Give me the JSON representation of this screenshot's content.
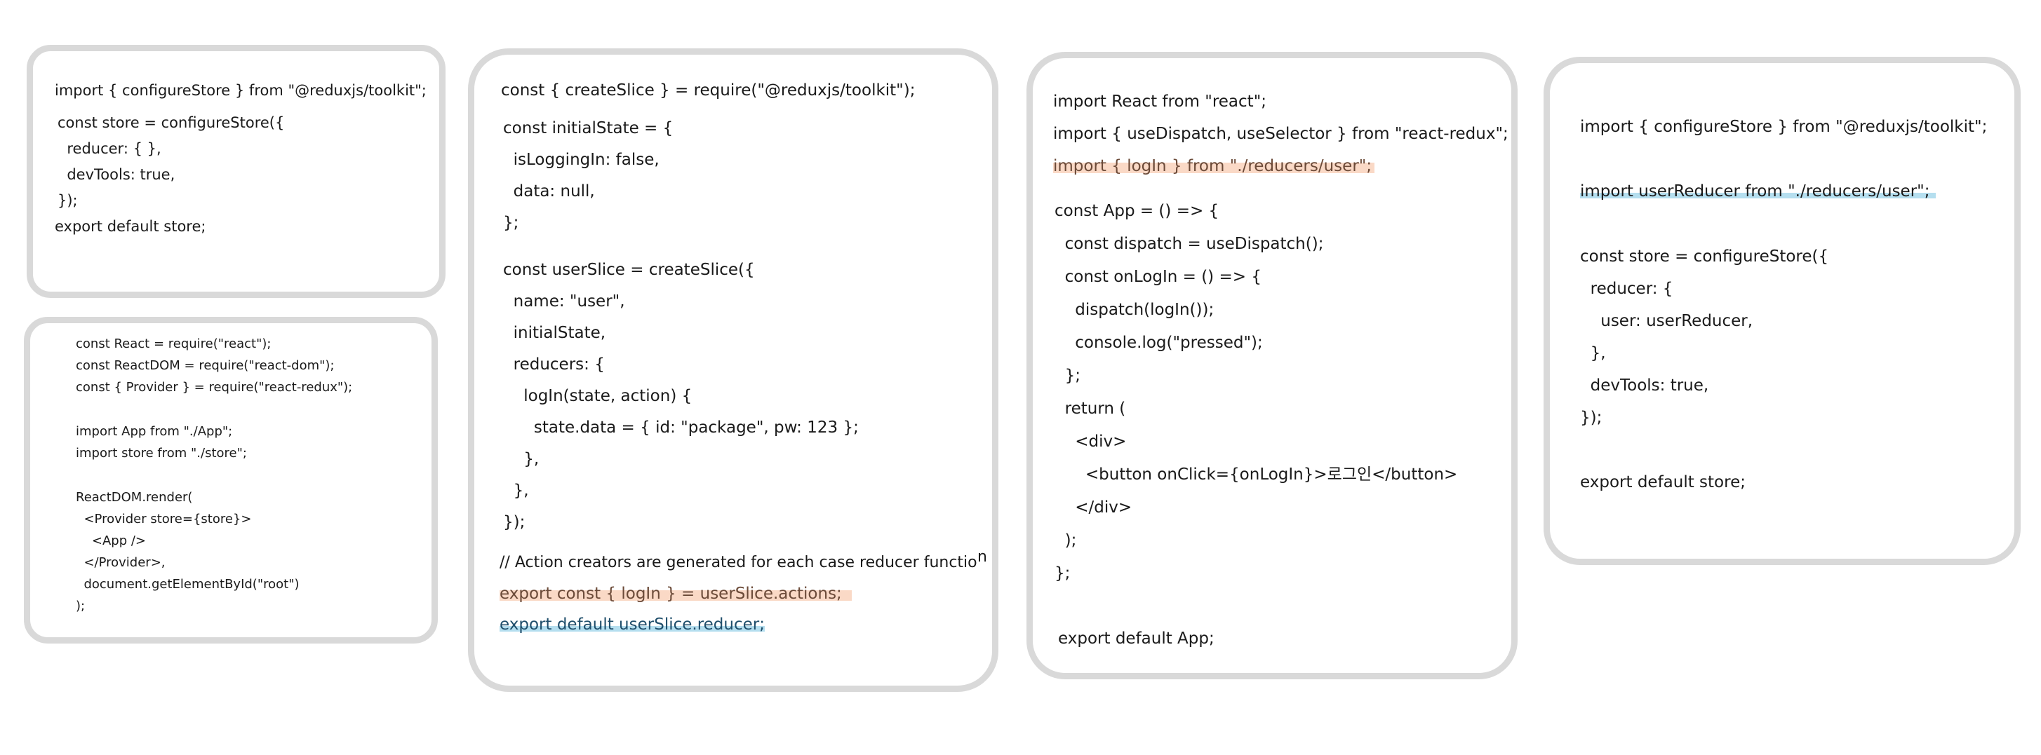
{
  "panels": {
    "store_basic": {
      "lines": [
        "import { configureStore } from \"@reduxjs/toolkit\";",
        "const store = configureStore({",
        "  reducer: { },",
        "  devTools: true,",
        "});",
        "export default store;"
      ]
    },
    "index": {
      "lines": [
        "const React = require(\"react\");",
        "const ReactDOM = require(\"react-dom\");",
        "const { Provider } = require(\"react-redux\");",
        "import App from \"./App\";",
        "import store from \"./store\";",
        "ReactDOM.render(",
        "  <Provider store={store}>",
        "    <App />",
        "  </Provider>,",
        "  document.getElementById(\"root\")",
        ");"
      ]
    },
    "user_slice": {
      "lines": [
        "const { createSlice } = require(\"@reduxjs/toolkit\");",
        "const initialState = {",
        "  isLoggingIn: false,",
        "  data: null,",
        "};",
        "const userSlice = createSlice({",
        "  name: \"user\",",
        "  initialState,",
        "  reducers: {",
        "    logIn(state, action) {",
        "      state.data = { id: \"package\", pw: 123 };",
        "    },",
        "  },",
        "});",
        "// Action creators are generated for each case reducer functio",
        "n",
        "export const { logIn } = userSlice.actions;",
        "export default userSlice.reducer;"
      ]
    },
    "app": {
      "lines": [
        "import React from \"react\";",
        "import { useDispatch, useSelector } from \"react-redux\";",
        "import { logIn } from \"./reducers/user\";",
        "const App = () => {",
        "  const dispatch = useDispatch();",
        "  const onLogIn = () => {",
        "    dispatch(logIn());",
        "    console.log(\"pressed\");",
        "  };",
        "  return (",
        "    <div>",
        "      <button onClick={onLogIn}>로그인</button>",
        "    </div>",
        "  );",
        "};",
        "export default App;"
      ]
    },
    "store_full": {
      "lines": [
        "import { configureStore } from \"@reduxjs/toolkit\";",
        "import userReducer from \"./reducers/user\";",
        "const store = configureStore({",
        "  reducer: {",
        "    user: userReducer,",
        "  },",
        "  devTools: true,",
        "});",
        "export default store;"
      ]
    }
  },
  "colors": {
    "card_border": "#d9d9d9",
    "orange_highlight": "#f4a478",
    "blue_underline": "#78c4e2"
  }
}
